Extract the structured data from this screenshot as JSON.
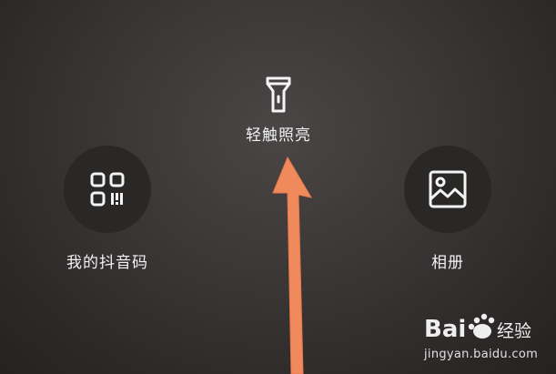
{
  "flashlight": {
    "label": "轻触照亮",
    "icon": "flashlight-icon"
  },
  "qr_code": {
    "label": "我的抖音码",
    "icon": "qr-code-icon"
  },
  "album": {
    "label": "相册",
    "icon": "image-icon"
  },
  "annotation": {
    "arrow_color": "#f08a5d",
    "direction": "up"
  },
  "watermark": {
    "brand": "Bai",
    "brand_suffix": "经验",
    "url": "jingyan.baidu.com"
  },
  "colors": {
    "background": "#3a3636",
    "button": "#2a2727",
    "text": "#f2f2f2"
  }
}
